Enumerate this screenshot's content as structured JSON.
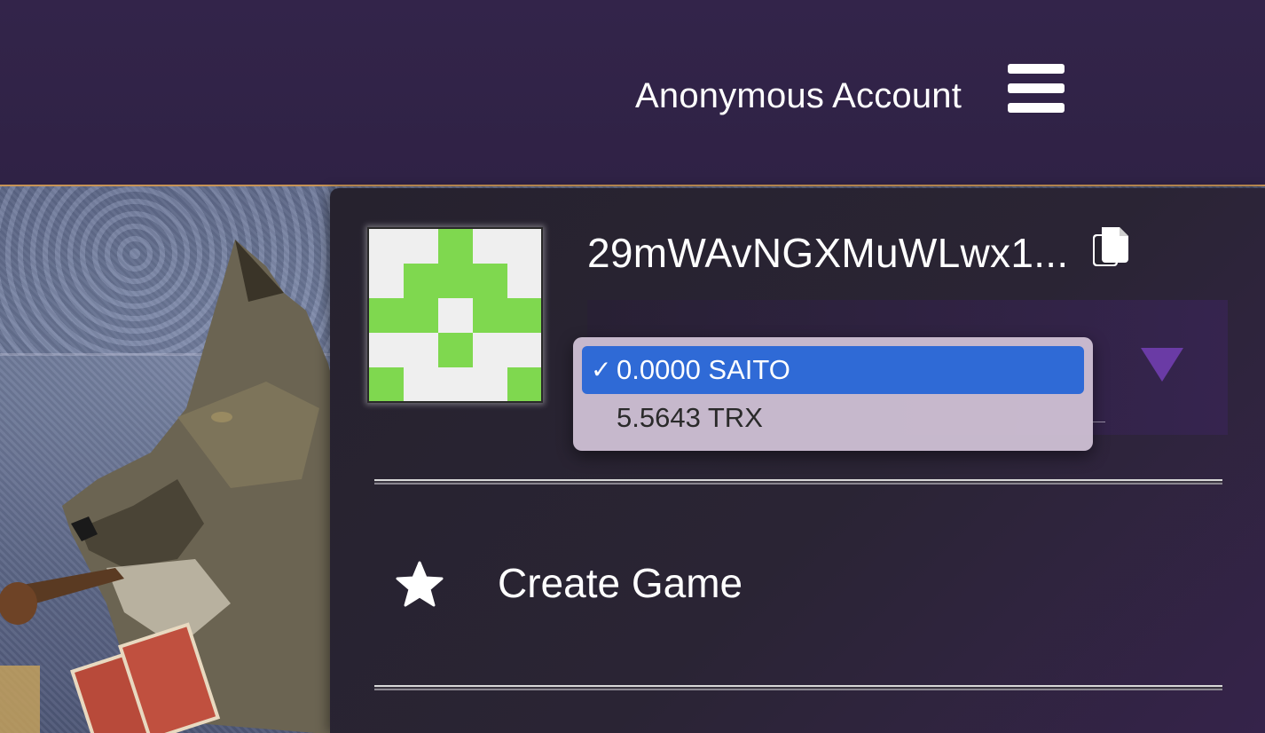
{
  "header": {
    "account_label": "Anonymous Account",
    "menu_icon": "hamburger-menu-icon"
  },
  "account": {
    "address": "29mWAvNGXMuWLwx1...",
    "copy_icon": "copy-icon",
    "identicon_colors": {
      "foreground": "#7fd84f",
      "background": "#efefef"
    }
  },
  "balance_select": {
    "options": [
      {
        "label": "0.0000 SAITO",
        "selected": true
      },
      {
        "label": "5.5643 TRX",
        "selected": false
      }
    ],
    "check_mark": "✓",
    "accent_color": "#2f6ad6",
    "arrow_color": "#6a3ba5"
  },
  "menu": {
    "items": [
      {
        "label": "Create Game",
        "icon": "star-icon"
      }
    ]
  }
}
